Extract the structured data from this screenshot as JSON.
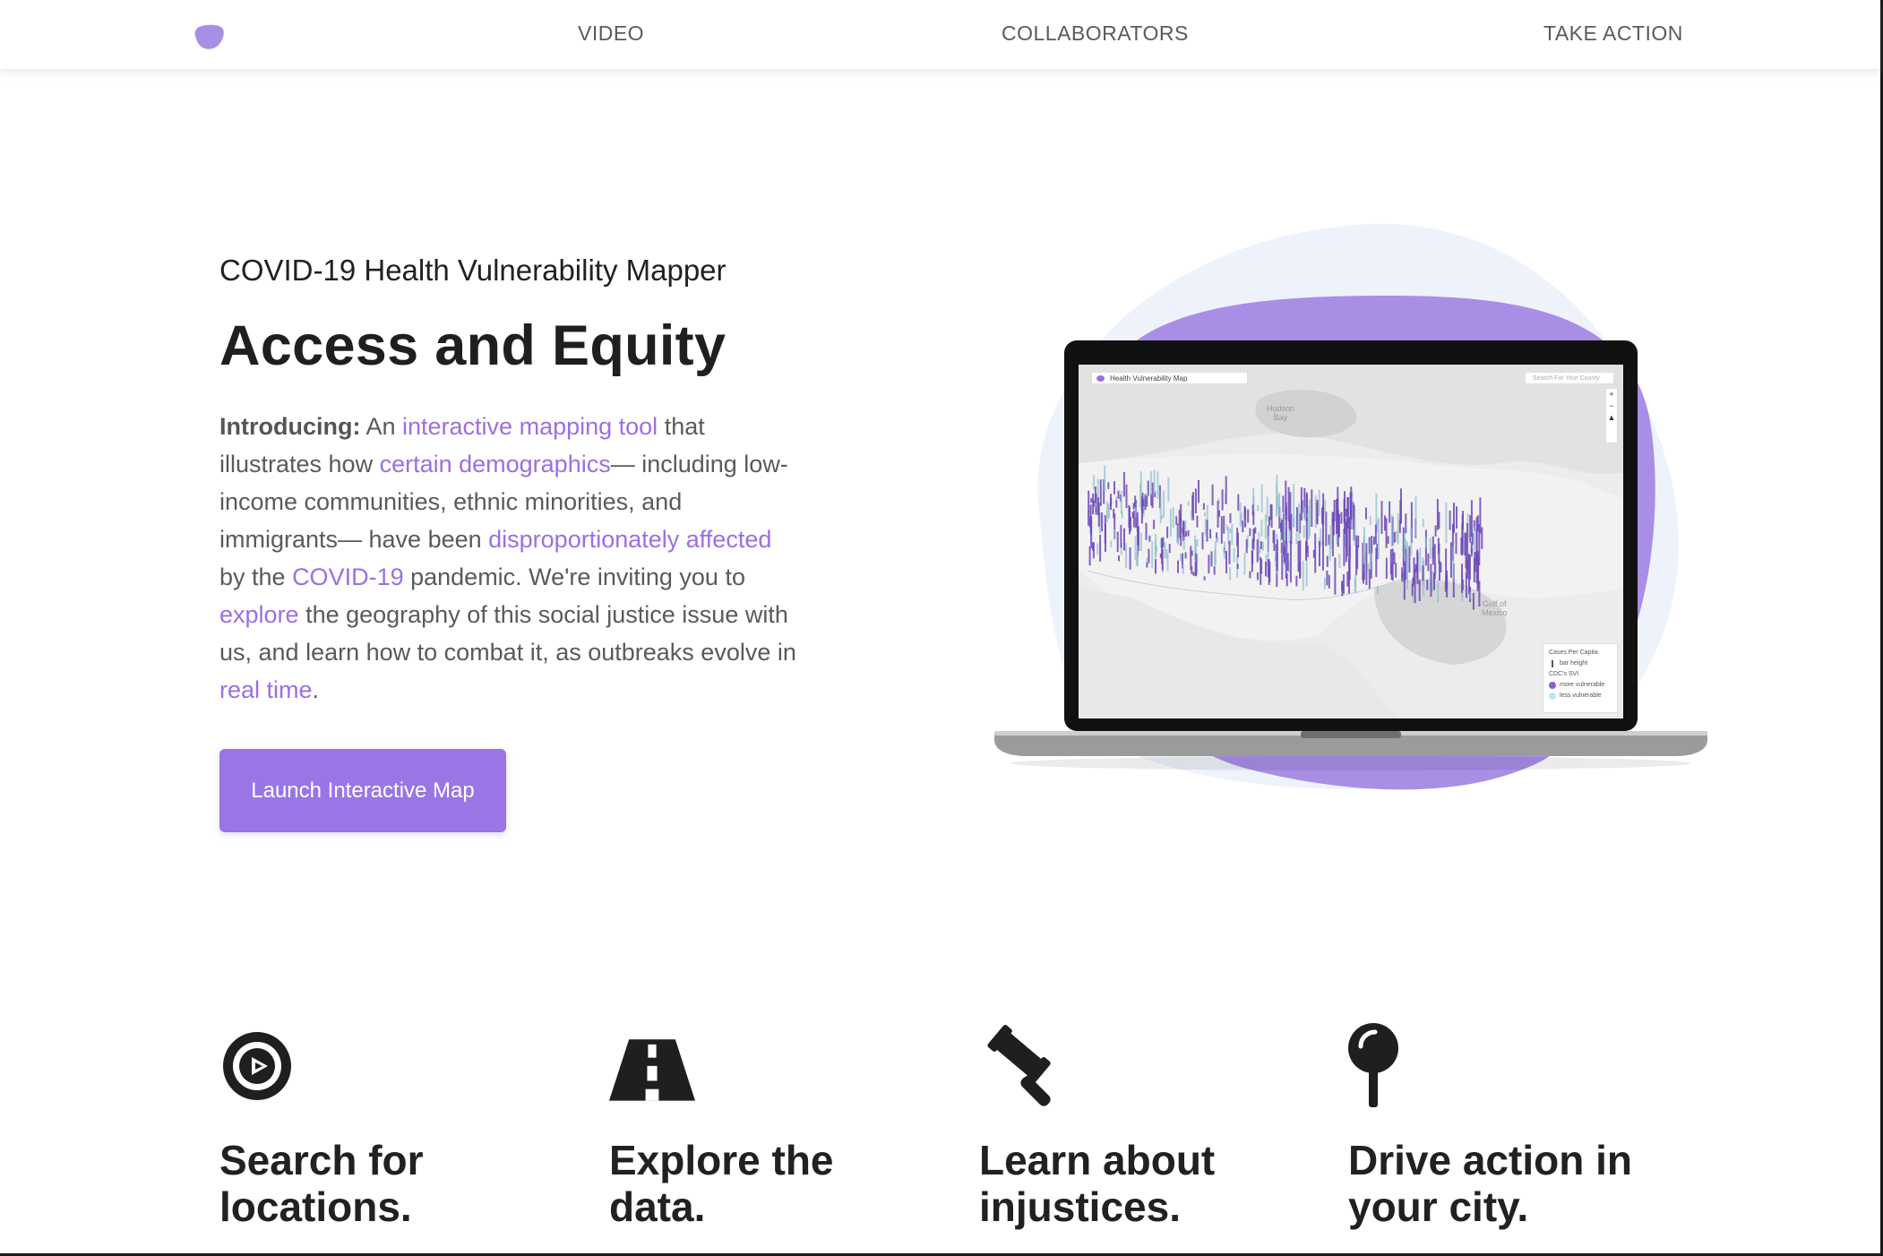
{
  "nav": {
    "logo_icon": "blob-logo-icon",
    "links": [
      {
        "label": "VIDEO"
      },
      {
        "label": "COLLABORATORS"
      },
      {
        "label": "TAKE ACTION"
      }
    ]
  },
  "hero": {
    "subtitle": "COVID-19 Health Vulnerability Mapper",
    "title": "Access and Equity",
    "intro": {
      "lead": "Introducing:",
      "t1": " An ",
      "link1": "interactive mapping tool",
      "t2": " that illustrates how ",
      "link2": "certain demographics",
      "t3": "— including low-income communities, ethnic minorities, and immigrants— have been ",
      "link3": "disproportionately affected",
      "t4": " by the ",
      "link4": "COVID-19",
      "t5": " pandemic. We're inviting you to ",
      "link5": "explore",
      "t6": " the geography of this social justice issue with us, and learn how to combat it, as outbreaks evolve in ",
      "link6": "real time",
      "t7": "."
    },
    "cta_label": "Launch Interactive Map"
  },
  "map_preview": {
    "dropdown_label": "Health Vulnerability Map",
    "search_placeholder": "Search For Your County",
    "labels": {
      "hudson_bay": "Hudson\nBay",
      "gulf_mexico": "Gulf of\nMexico"
    },
    "legend": {
      "title": "Cases Per Capita",
      "bar_label": "bar height",
      "cdc_label": "CDC's SVI",
      "more": "more vulnerable",
      "less": "less vulnerable"
    },
    "zoom": {
      "plus": "+",
      "minus": "−",
      "compass": "▲"
    }
  },
  "features": [
    {
      "icon": "compass-icon",
      "title": "Search for locations."
    },
    {
      "icon": "road-icon",
      "title": "Explore the data."
    },
    {
      "icon": "gavel-icon",
      "title": "Learn about injustices."
    },
    {
      "icon": "map-pin-icon",
      "title": "Drive action in your city."
    }
  ],
  "colors": {
    "accent": "#9a75e6",
    "link": "#9b6fe3",
    "blob_light": "#eef3fb",
    "blob_purple": "#a98ee6",
    "text_dark": "#212121",
    "text_body": "#5a5a5a"
  }
}
